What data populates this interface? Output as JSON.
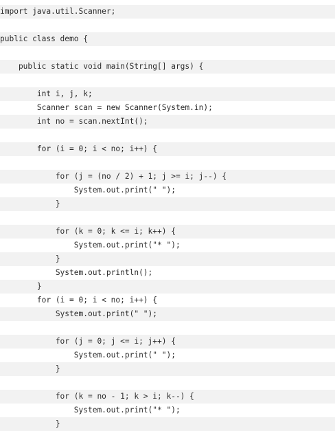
{
  "code": {
    "lines": [
      "import java.util.Scanner;",
      "",
      "public class demo {",
      "",
      "    public static void main(String[] args) {",
      "",
      "        int i, j, k;",
      "        Scanner scan = new Scanner(System.in);",
      "        int no = scan.nextInt();",
      "",
      "        for (i = 0; i < no; i++) {",
      "",
      "            for (j = (no / 2) + 1; j >= i; j--) {",
      "                System.out.print(\" \");",
      "            }",
      "",
      "            for (k = 0; k <= i; k++) {",
      "                System.out.print(\"* \");",
      "            }",
      "            System.out.println();",
      "        }",
      "        for (i = 0; i < no; i++) {",
      "            System.out.print(\" \");",
      "",
      "            for (j = 0; j <= i; j++) {",
      "                System.out.print(\" \");",
      "            }",
      "",
      "            for (k = no - 1; k > i; k--) {",
      "                System.out.print(\"* \");",
      "            }"
    ]
  }
}
